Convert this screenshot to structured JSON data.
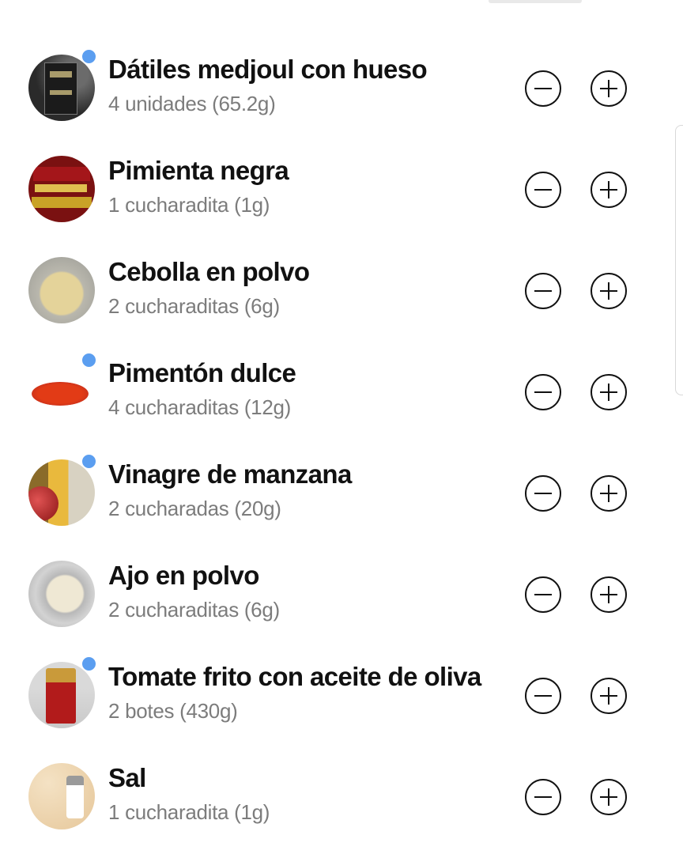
{
  "items": [
    {
      "name": "Dátiles medjoul con hueso",
      "qty": "4 unidades (65.2g)",
      "image": "medjoul-dates-package",
      "highlight": true
    },
    {
      "name": "Pimienta negra",
      "qty": "1 cucharadita (1g)",
      "image": "black-pepper-jar",
      "highlight": false
    },
    {
      "name": "Cebolla en polvo",
      "qty": "2 cucharaditas (6g)",
      "image": "onion-powder-bowl",
      "highlight": false
    },
    {
      "name": "Pimentón dulce",
      "qty": "4 cucharaditas (12g)",
      "image": "paprika-pile",
      "highlight": true
    },
    {
      "name": "Vinagre de manzana",
      "qty": "2 cucharadas (20g)",
      "image": "apple-cider-vinegar",
      "highlight": true
    },
    {
      "name": "Ajo en polvo",
      "qty": "2 cucharaditas (6g)",
      "image": "garlic-powder-spoon",
      "highlight": false
    },
    {
      "name": "Tomate frito con aceite de oliva",
      "qty": "2 botes (430g)",
      "image": "tomato-sauce-jar",
      "highlight": true
    },
    {
      "name": "Sal",
      "qty": "1 cucharadita (1g)",
      "image": "salt-shaker",
      "highlight": false
    }
  ],
  "icons": {
    "decrease": "minus-circle-icon",
    "increase": "plus-circle-icon"
  },
  "colors": {
    "dot": "#5b9ef0",
    "quantity_text": "#7c7c7c",
    "name_text": "#111111"
  }
}
